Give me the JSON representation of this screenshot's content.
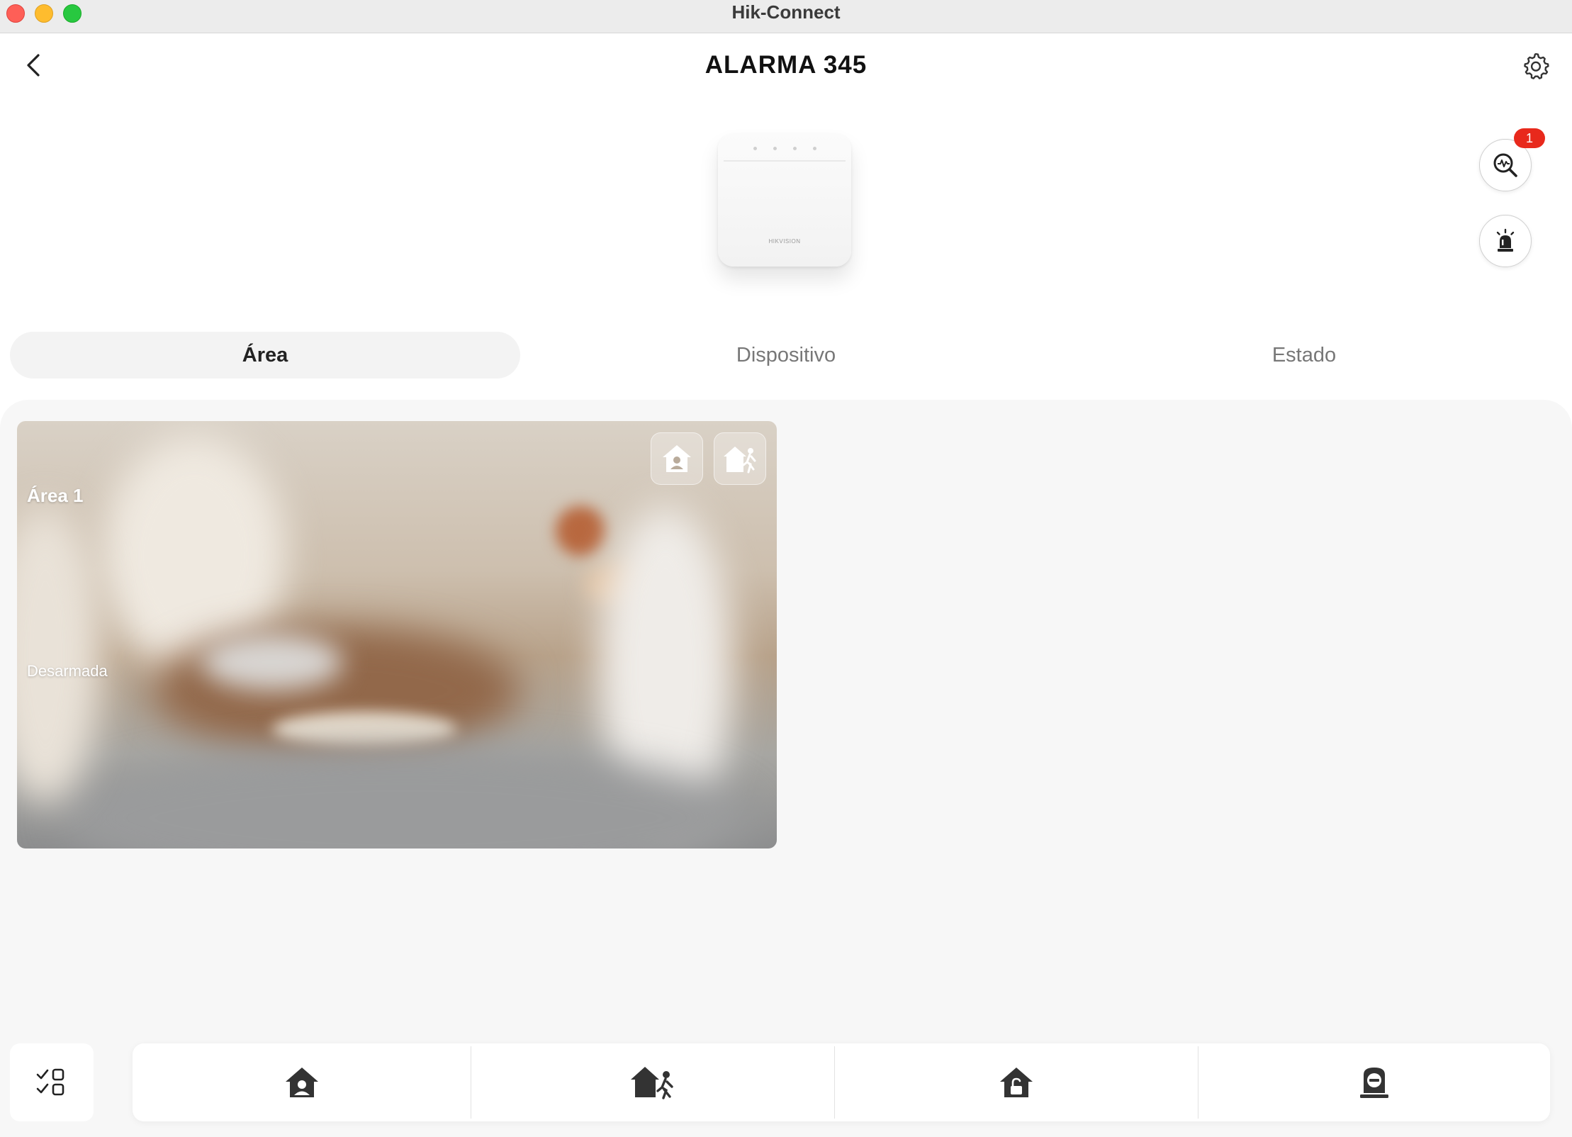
{
  "window": {
    "title": "Hik-Connect"
  },
  "header": {
    "title": "ALARMA 345",
    "back_icon": "chevron-left-icon",
    "settings_icon": "gear-icon"
  },
  "device": {
    "brand": "HIKVISION"
  },
  "side_actions": {
    "detection_badge": "1",
    "detection_icon": "search-activity-icon",
    "siren_icon": "siren-icon"
  },
  "tabs": [
    {
      "label": "Área",
      "active": true
    },
    {
      "label": "Dispositivo",
      "active": false
    },
    {
      "label": "Estado",
      "active": false
    }
  ],
  "areas": [
    {
      "name": "Área 1",
      "status": "Desarmada",
      "actions": [
        "stay-arm-icon",
        "away-arm-icon"
      ]
    }
  ],
  "bottom_bar": {
    "select_icon": "multi-select-icon",
    "actions": [
      "stay-arm-icon",
      "away-arm-icon",
      "disarm-icon",
      "clear-alarm-icon"
    ]
  },
  "colors": {
    "badge": "#e8291c",
    "background": "#f7f7f7",
    "icon": "#333333"
  }
}
